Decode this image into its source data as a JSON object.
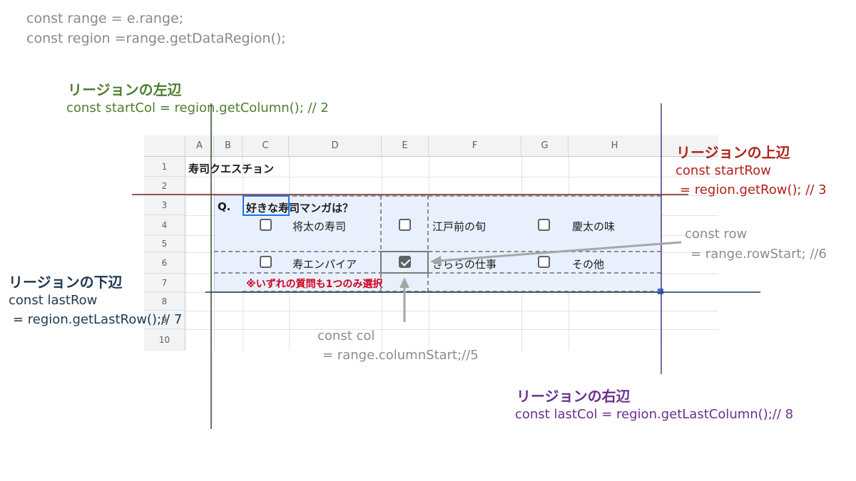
{
  "code": {
    "line1": "const range = e.range;",
    "line2": "const region =range.getDataRegion();"
  },
  "left_edge": {
    "title": "リージョンの左辺",
    "code": "const startCol = region.getColumn(); // 2"
  },
  "top_edge": {
    "title": "リージョンの上辺",
    "code1": "const startRow",
    "code2": "= region.getRow(); // 3"
  },
  "bottom_edge": {
    "title": "リージョンの下辺",
    "code1": "const lastRow",
    "code2": "= region.getLastRow();// 7"
  },
  "right_edge": {
    "title": "リージョンの右辺",
    "code": "const lastCol = region.getLastColumn();// 8"
  },
  "row_label": {
    "code1": "const row",
    "code2": "= range.rowStart; //6"
  },
  "col_label": {
    "code1": "const col",
    "code2": "= range.columnStart;//5"
  },
  "sheet": {
    "columns": [
      "A",
      "B",
      "C",
      "D",
      "E",
      "F",
      "G",
      "H"
    ],
    "rows": [
      "1",
      "2",
      "3",
      "4",
      "5",
      "6",
      "7",
      "8",
      "9",
      "10"
    ],
    "a1": "寿司クエスチョン",
    "q_label": "Q.",
    "question": "好きな寿司マンガは？",
    "options": [
      "将太の寿司",
      "江戸前の旬",
      "慶太の味",
      "寿エンパイア",
      "きららの仕事",
      "その他"
    ],
    "note": "※いずれの質問も1つのみ選択",
    "checked_option": "きららの仕事"
  },
  "colors": {
    "left_line": "#2f4f2a",
    "top_line": "#7a1f1f",
    "bottom_line": "#1f3850",
    "right_line": "#5b3a80",
    "region_fill": "#e8f0fe",
    "note_red": "#d0021b"
  }
}
